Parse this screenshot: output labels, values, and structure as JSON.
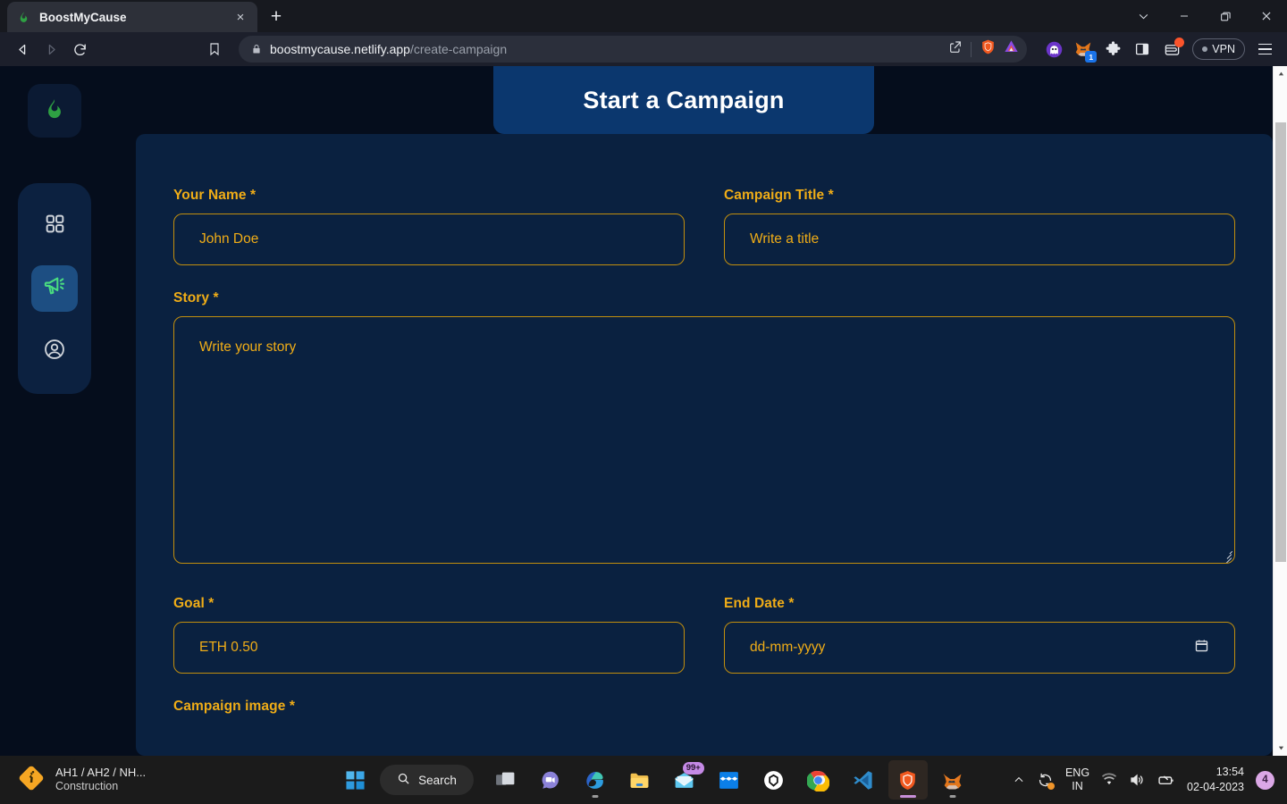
{
  "browser": {
    "tab": {
      "title": "BoostMyCause",
      "favicon": "flame-icon",
      "close_label": "×"
    },
    "new_tab_label": "+",
    "window_controls": {
      "tab_search": "tab-search-icon",
      "minimize": "minimize-icon",
      "restore": "restore-icon",
      "close": "close-icon"
    },
    "nav": {
      "back": "back-arrow-icon",
      "forward": "forward-arrow-icon",
      "reload": "reload-icon",
      "bookmark": "bookmark-icon"
    },
    "url": {
      "domain": "boostmycause.netlify.app",
      "path": "/create-campaign",
      "lock": "lock-icon",
      "share": "share-icon"
    },
    "toolbar_icons": [
      "brave-shield-icon",
      "brave-rewards-icon",
      "ghost-extension-icon",
      "metamask-fox-icon",
      "extensions-puzzle-icon",
      "sidebar-panel-icon",
      "wallet-icon"
    ],
    "metamask_badge": "1",
    "vpn_label": "VPN"
  },
  "app": {
    "sidebar": {
      "logo": "flame-logo-icon",
      "items": [
        {
          "name": "dashboard",
          "icon": "grid-icon",
          "active": false
        },
        {
          "name": "campaign",
          "icon": "megaphone-icon",
          "active": true
        },
        {
          "name": "profile",
          "icon": "user-circle-icon",
          "active": false
        }
      ]
    },
    "header": {
      "title": "Start a Campaign"
    },
    "form": {
      "fields": [
        {
          "key": "your_name",
          "label": "Your Name *",
          "placeholder": "John Doe",
          "type": "text"
        },
        {
          "key": "campaign_title",
          "label": "Campaign Title *",
          "placeholder": "Write a title",
          "type": "text"
        },
        {
          "key": "story",
          "label": "Story *",
          "placeholder": "Write your story",
          "type": "textarea"
        },
        {
          "key": "goal",
          "label": "Goal *",
          "placeholder": "ETH 0.50",
          "type": "text"
        },
        {
          "key": "end_date",
          "label": "End Date *",
          "placeholder": "dd-mm-yyyy",
          "type": "date"
        },
        {
          "key": "campaign_image",
          "label": "Campaign image *",
          "placeholder": "",
          "type": "text"
        }
      ]
    },
    "colors": {
      "accent": "#f0ad17",
      "card": "#0a2140",
      "page_bg": "#050d1c",
      "header_bg": "#0b376e",
      "nav_active": "#1d4e82"
    }
  },
  "taskbar": {
    "widget": {
      "line1": "AH1 / AH2 / NH...",
      "line2": "Construction",
      "icon": "construction-sign-icon"
    },
    "start": "windows-start-icon",
    "search": {
      "label": "Search",
      "icon": "search-icon"
    },
    "apps": [
      {
        "name": "task-view",
        "icon": "task-view-icon"
      },
      {
        "name": "teams-chat",
        "icon": "chat-icon"
      },
      {
        "name": "microsoft-edge",
        "icon": "edge-icon"
      },
      {
        "name": "file-explorer",
        "icon": "folder-icon"
      },
      {
        "name": "mail",
        "icon": "mail-icon",
        "badge": "99+"
      },
      {
        "name": "dropbox",
        "icon": "dropbox-icon"
      },
      {
        "name": "brave-nightly",
        "icon": "home-shield-icon"
      },
      {
        "name": "google-chrome",
        "icon": "chrome-icon"
      },
      {
        "name": "visual-studio-code",
        "icon": "vscode-icon"
      },
      {
        "name": "brave-browser",
        "icon": "brave-lion-icon"
      },
      {
        "name": "firefox",
        "icon": "firefox-fox-icon"
      }
    ],
    "tray": {
      "overflow": "chevron-up-icon",
      "sync": "sync-icon",
      "language": {
        "line1": "ENG",
        "line2": "IN"
      },
      "wifi": "wifi-icon",
      "volume": "volume-icon",
      "battery": "battery-icon",
      "time": "13:54",
      "date": "02-04-2023",
      "notifications": "4"
    }
  }
}
